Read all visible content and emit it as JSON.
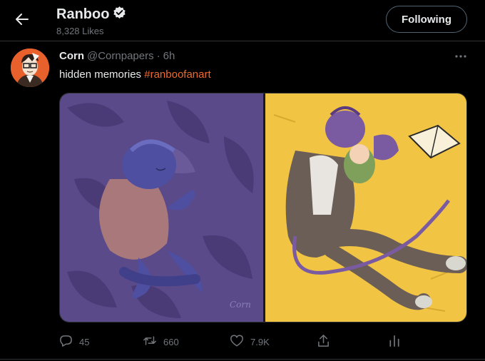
{
  "header": {
    "title": "Ranboo",
    "likes_count": "8,328 Likes",
    "follow_label": "Following"
  },
  "tweet": {
    "author_name": "Corn",
    "author_handle": "@Cornpapers",
    "separator": "·",
    "time": "6h",
    "text": "hidden memories ",
    "hashtag": "#ranboofanart",
    "artist_signature": "Corn"
  },
  "actions": {
    "replies": "45",
    "retweets": "660",
    "likes": "7.9K"
  },
  "colors": {
    "background": "#000000",
    "accent_hashtag": "#f0692d",
    "muted_text": "#71767b",
    "border": "#2f3336",
    "panel_left_bg": "#5a4a8a",
    "panel_right_bg": "#f2c443"
  },
  "icons": {
    "back": "arrow-left-icon",
    "verified": "verified-badge-icon",
    "more": "more-dots-icon",
    "reply": "reply-icon",
    "retweet": "retweet-icon",
    "like": "heart-icon",
    "share": "share-icon",
    "analytics": "analytics-icon"
  }
}
